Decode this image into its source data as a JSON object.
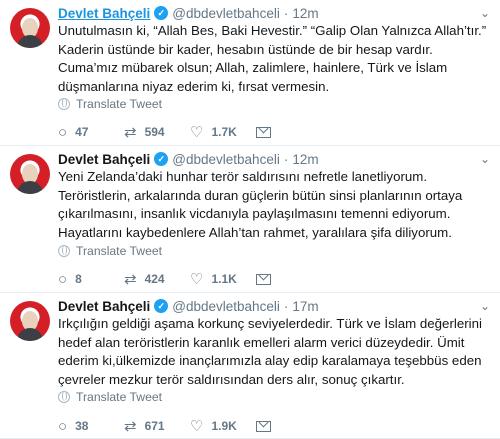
{
  "translate_label": "Translate Tweet",
  "tweets": [
    {
      "name": "Devlet Bahçeli",
      "handle": "@dbdevletbahceli",
      "time": "12m",
      "text": "Unutulmasın ki, “Allah Bes, Baki Hevestir.” “Galip Olan Yalnızca Allah’tır.” Kaderin üstünde bir kader, hesabın üstünde de bir hesap vardır. Cuma’mız mübarek olsun; Allah, zalimlere, hainlere, Türk ve İslam düşmanlarına niyaz ederim ki, fırsat vermesin.",
      "replies": "47",
      "retweets": "594",
      "likes": "1.7K"
    },
    {
      "name": "Devlet Bahçeli",
      "handle": "@dbdevletbahceli",
      "time": "12m",
      "text": "Yeni Zelanda’daki hunhar terör saldırısını nefretle lanetliyorum. Teröristlerin, arkalarında duran güçlerin bütün sinsi planlarının ortaya çıkarılmasını, insanlık vicdanıyla paylaşılmasını temenni ediyorum. Hayatlarını kaybedenlere Allah’tan rahmet, yaralılara şifa diliyorum.",
      "replies": "8",
      "retweets": "424",
      "likes": "1.1K"
    },
    {
      "name": "Devlet Bahçeli",
      "handle": "@dbdevletbahceli",
      "time": "17m",
      "text": "Irkçılığın geldiği aşama korkunç seviyelerdedir. Türk ve İslam değerlerini hedef alan teröristlerin karanlık emelleri alarm verici düzeydedir. Ümit ederim ki,ülkemizde inançlarımızla alay edip karalamaya teşebbüs eden çevreler mezkur terör saldırısından ders alır, sonuç çıkartır.",
      "replies": "38",
      "retweets": "671",
      "likes": "1.9K"
    }
  ],
  "colors": {
    "accent": "#1da1f2",
    "link": "#1b95e0",
    "muted": "#657786",
    "divider": "#e6ecf0"
  },
  "icons": [
    "verified-icon",
    "chevron-down-icon",
    "globe-icon",
    "reply-icon",
    "retweet-icon",
    "like-icon",
    "message-icon"
  ]
}
